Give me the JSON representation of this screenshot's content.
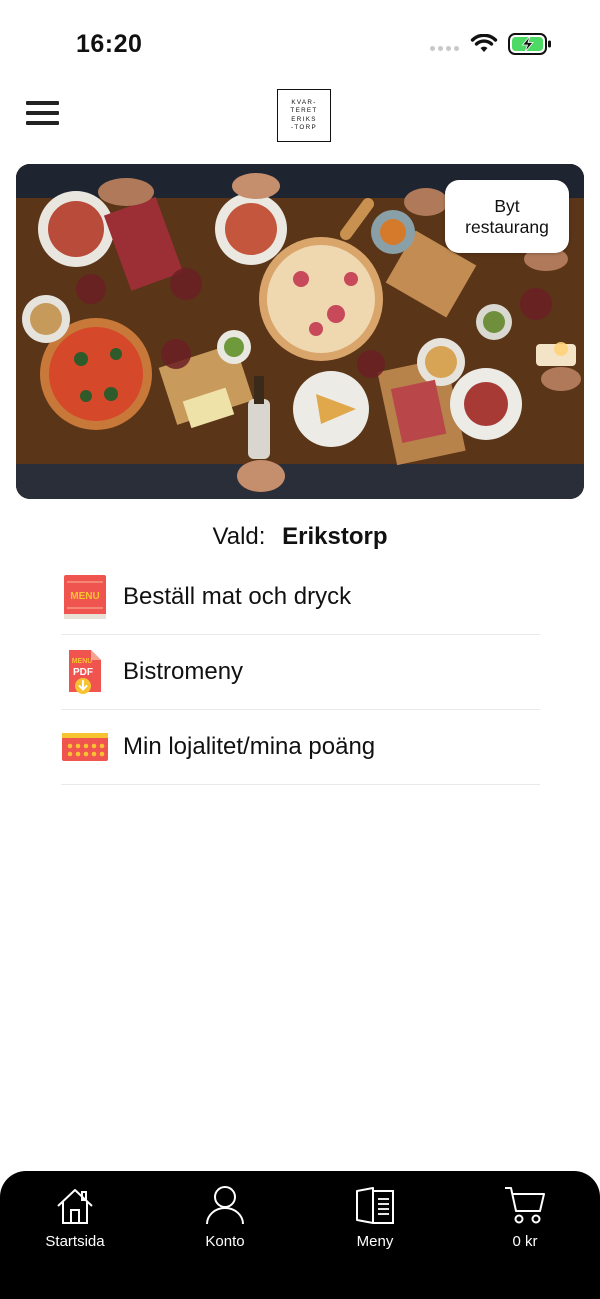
{
  "status_bar": {
    "time": "16:20",
    "icons": [
      "cellular-signal-icon",
      "wifi-icon",
      "battery-charging-icon"
    ]
  },
  "header": {
    "menu_icon": "hamburger-icon",
    "logo_lines": [
      "KVAR-",
      "TERET",
      "ERIKS",
      "-TORP"
    ]
  },
  "hero": {
    "switch_button_line1": "Byt",
    "switch_button_line2": "restaurang"
  },
  "selected": {
    "label": "Vald:",
    "value": "Erikstorp"
  },
  "menu_items": [
    {
      "label": "Beställ mat och dryck",
      "icon": "menu-book-icon"
    },
    {
      "label": "Bistromeny",
      "icon": "pdf-menu-download-icon"
    },
    {
      "label": "Min lojalitet/mina poäng",
      "icon": "loyalty-card-icon"
    }
  ],
  "icon_text": {
    "menu_book": "MENU",
    "pdf_top": "MENU",
    "pdf_bottom": "PDF"
  },
  "tab_bar": {
    "tabs": [
      {
        "label": "Startsida",
        "icon": "home-icon"
      },
      {
        "label": "Konto",
        "icon": "user-icon"
      },
      {
        "label": "Meny",
        "icon": "book-icon"
      },
      {
        "label": "0 kr",
        "icon": "cart-icon"
      }
    ]
  },
  "colors": {
    "icon_accent": "#f0544f",
    "icon_yellow": "#f7c331",
    "tab_bar_bg": "#000000",
    "separator": "#e9e9e9"
  }
}
